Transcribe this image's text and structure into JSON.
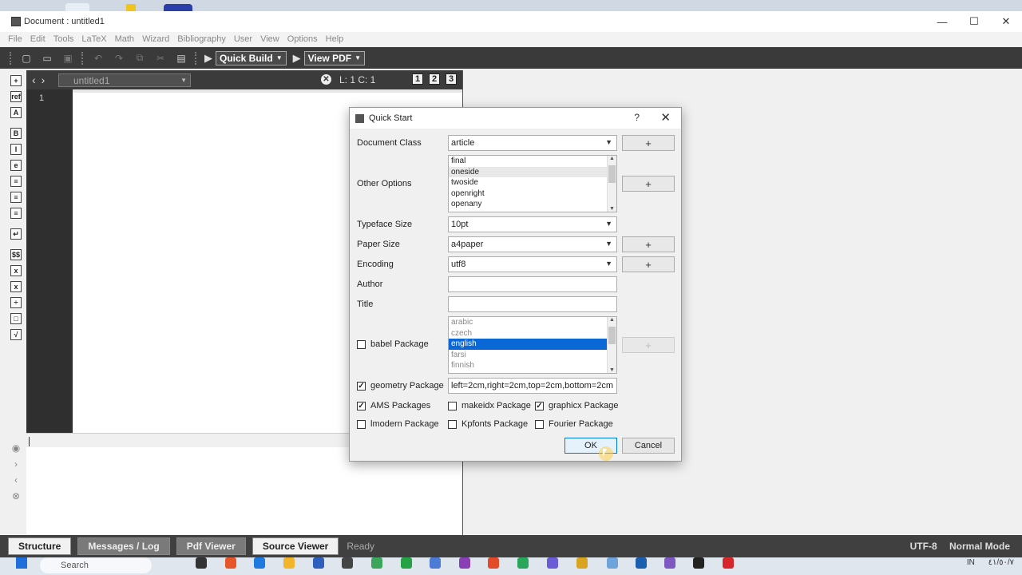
{
  "window": {
    "title": "Document : untitled1",
    "minimize": "—",
    "maximize": "☐",
    "close": "✕"
  },
  "menubar": [
    "File",
    "Edit",
    "Tools",
    "LaTeX",
    "Math",
    "Wizard",
    "Bibliography",
    "User",
    "View",
    "Options",
    "Help"
  ],
  "toolbar": {
    "quick_build": "Quick Build",
    "view_pdf": "View PDF"
  },
  "editor": {
    "file_combo": "untitled1",
    "cursor_pos": "L: 1 C: 1",
    "view_buttons": [
      "1",
      "2",
      "3"
    ],
    "line_number": "1"
  },
  "sidebar": {
    "icons": [
      "insert-icon",
      "ref-icon",
      "symbol-icon",
      "bold-icon",
      "italic-icon",
      "emph-icon",
      "align-left-icon",
      "align-center-icon",
      "align-right-icon",
      "newline-icon",
      "dollar-icon",
      "fraction-icon",
      "subscript-icon",
      "divide-icon",
      "matrix-icon",
      "sqrt-icon"
    ],
    "glyphs": [
      "+",
      "ref",
      "A",
      "B",
      "I",
      "e",
      "≡",
      "≡",
      "≡",
      "↵",
      "$$",
      "x",
      "x",
      "÷",
      "□",
      "√"
    ]
  },
  "dialog": {
    "title": "Quick Start",
    "help": "?",
    "close": "✕",
    "document_class_label": "Document Class",
    "document_class_value": "article",
    "other_options_label": "Other Options",
    "other_options": [
      "final",
      "oneside",
      "twoside",
      "openright",
      "openany"
    ],
    "typeface_size_label": "Typeface Size",
    "typeface_size_value": "10pt",
    "paper_size_label": "Paper Size",
    "paper_size_value": "a4paper",
    "encoding_label": "Encoding",
    "encoding_value": "utf8",
    "author_label": "Author",
    "author_value": "",
    "title_label": "Title",
    "title_value": "",
    "babel_label": "babel Package",
    "babel_checked": false,
    "babel_languages": [
      "arabic",
      "czech",
      "english",
      "farsi",
      "finnish"
    ],
    "babel_selected": "english",
    "geometry_label": "geometry Package",
    "geometry_checked": true,
    "geometry_value": "left=2cm,right=2cm,top=2cm,bottom=2cm",
    "ams_label": "AMS Packages",
    "ams_checked": true,
    "makeidx_label": "makeidx Package",
    "makeidx_checked": false,
    "graphicx_label": "graphicx Package",
    "graphicx_checked": true,
    "lmodern_label": "lmodern Package",
    "lmodern_checked": false,
    "kpfonts_label": "Kpfonts Package",
    "kpfonts_checked": false,
    "fourier_label": "Fourier Package",
    "fourier_checked": false,
    "plus": "+",
    "ok": "OK",
    "cancel": "Cancel"
  },
  "statusbar": {
    "tabs": [
      "Structure",
      "Messages / Log",
      "Pdf Viewer",
      "Source Viewer"
    ],
    "ready": "Ready",
    "encoding": "UTF-8",
    "mode": "Normal Mode"
  },
  "taskbar": {
    "search": "Search",
    "lang": "IN",
    "clock": "٤١/٥٠/٧"
  }
}
